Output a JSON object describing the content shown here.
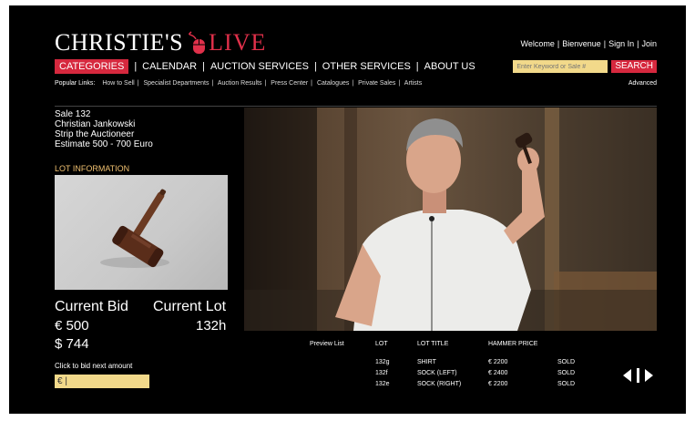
{
  "brand": {
    "name": "CHRISTIE'S",
    "live": "LIVE",
    "accent": "#d6283e"
  },
  "topbar": {
    "welcome": "Welcome",
    "bienvenue": "Bienvenue",
    "signin": "Sign In",
    "join": "Join"
  },
  "nav": {
    "categories": "CATEGORIES",
    "items": [
      "CALENDAR",
      "AUCTION SERVICES",
      "OTHER SERVICES",
      "ABOUT US"
    ]
  },
  "search": {
    "placeholder": "Enter Keyword or Sale #",
    "button": "SEARCH",
    "advanced": "Advanced"
  },
  "popular": {
    "label": "Popular Links:",
    "links": [
      "How to Sell",
      "Specialist Departments",
      "Auction Results",
      "Press Center",
      "Catalogues",
      "Private Sales",
      "Artists"
    ]
  },
  "sale": {
    "number": "Sale 132",
    "artist": "Christian Jankowski",
    "title": "Strip the Auctioneer",
    "estimate": "Estimate 500 - 700 Euro"
  },
  "lot_info_label": "LOT INFORMATION",
  "bid": {
    "current_bid_label": "Current Bid",
    "current_lot_label": "Current Lot",
    "euro": "€  500",
    "usd": "$  744",
    "lot": "132h",
    "click_label": "Click to bid next amount",
    "input_value": "€  |"
  },
  "lots_table": {
    "preview_label": "Preview List",
    "headers": [
      "LOT",
      "LOT TITLE",
      "HAMMER PRICE"
    ],
    "rows": [
      {
        "lot": "132g",
        "title": "SHIRT",
        "price": "€ 2200",
        "status": "SOLD"
      },
      {
        "lot": "132f",
        "title": "SOCK (LEFT)",
        "price": "€ 2400",
        "status": "SOLD"
      },
      {
        "lot": "132e",
        "title": "SOCK (RIGHT)",
        "price": "€ 2200",
        "status": "SOLD"
      }
    ]
  },
  "icons": {
    "pager": "pager-arrows-icon",
    "mouse": "mouse-icon",
    "gavel": "gavel-icon"
  }
}
